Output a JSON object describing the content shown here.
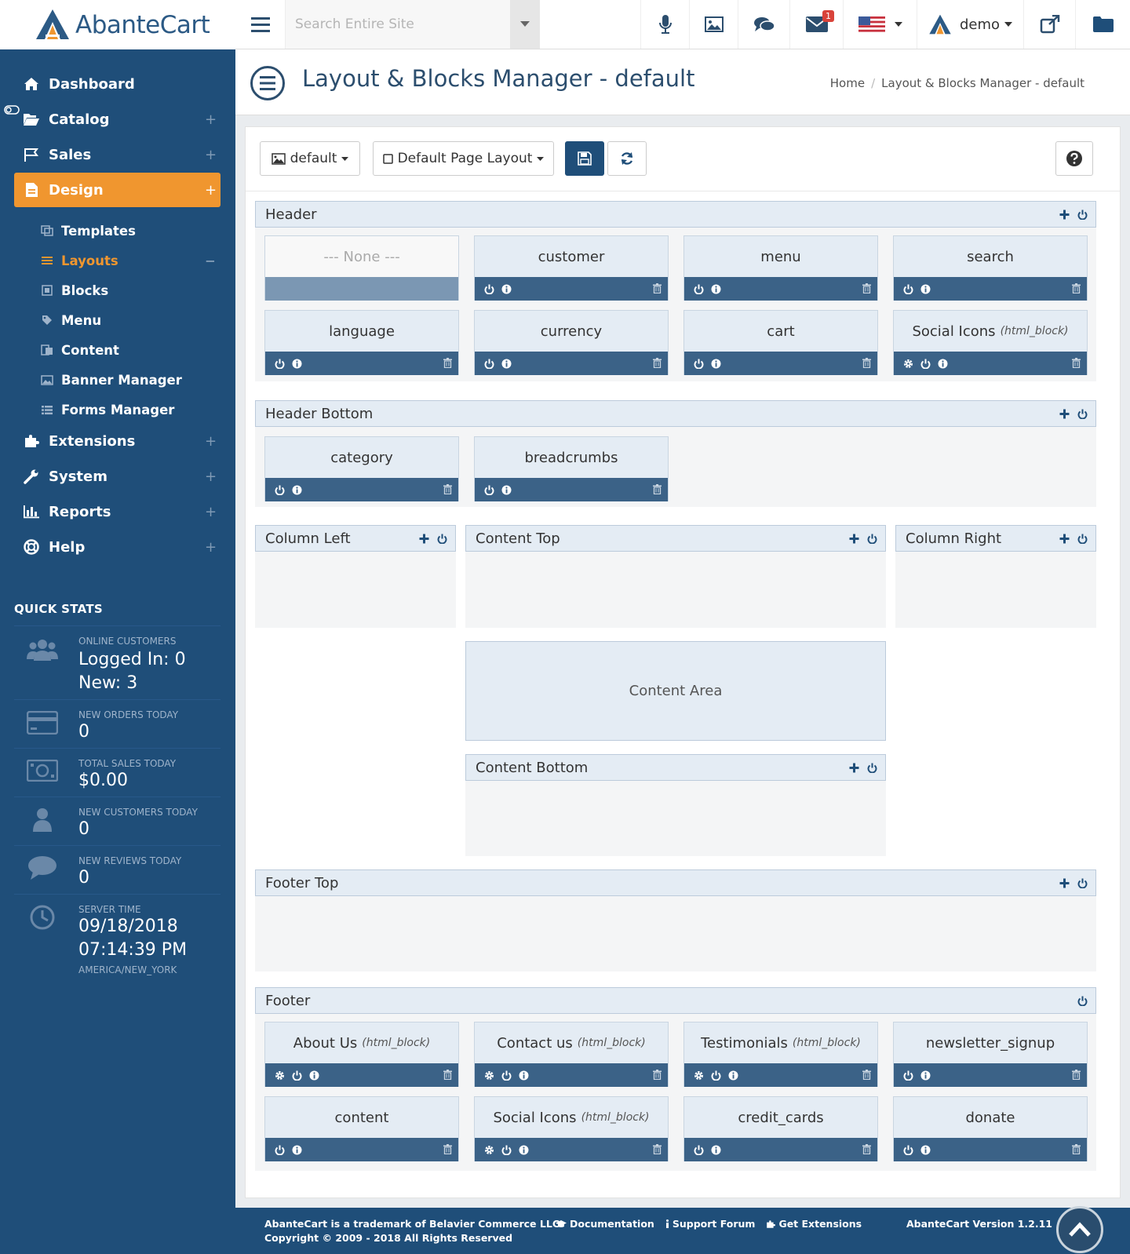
{
  "app": {
    "brand": "AbanteCart"
  },
  "topbar": {
    "search_placeholder": "Search Entire Site",
    "notification_count": "1",
    "user_name": "demo",
    "icons": [
      "microphone-icon",
      "image-icon",
      "chat-icon",
      "envelope-icon",
      "us-flag-icon",
      "external-link-icon",
      "folder-icon"
    ]
  },
  "sidebar": {
    "items": [
      {
        "label": "Dashboard",
        "icon": "home-icon"
      },
      {
        "label": "Catalog",
        "icon": "folder-open-icon"
      },
      {
        "label": "Sales",
        "icon": "flag-icon"
      },
      {
        "label": "Design",
        "icon": "file-icon",
        "active": true
      },
      {
        "label": "Extensions",
        "icon": "puzzle-icon"
      },
      {
        "label": "System",
        "icon": "wrench-icon"
      },
      {
        "label": "Reports",
        "icon": "bar-chart-icon"
      },
      {
        "label": "Help",
        "icon": "life-ring-icon"
      }
    ],
    "plus": "+",
    "minus": "−",
    "sub_items": [
      {
        "label": "Templates"
      },
      {
        "label": "Layouts",
        "current": true
      },
      {
        "label": "Blocks"
      },
      {
        "label": "Menu"
      },
      {
        "label": "Content"
      },
      {
        "label": "Banner Manager"
      },
      {
        "label": "Forms Manager"
      }
    ]
  },
  "quick_stats": {
    "title": "QUICK STATS",
    "online": {
      "label": "ONLINE CUSTOMERS",
      "logged_in": "Logged In: 0",
      "new": "New: 3"
    },
    "orders": {
      "label": "NEW ORDERS TODAY",
      "value": "0"
    },
    "sales": {
      "label": "TOTAL SALES TODAY",
      "value": "$0.00"
    },
    "customers": {
      "label": "NEW CUSTOMERS TODAY",
      "value": "0"
    },
    "reviews": {
      "label": "NEW REVIEWS TODAY",
      "value": "0"
    },
    "server": {
      "label": "SERVER TIME",
      "date": "09/18/2018",
      "time": "07:14:39 PM",
      "tz": "AMERICA/NEW_YORK"
    }
  },
  "page": {
    "title": "Layout & Blocks Manager - default",
    "breadcrumb_home": "Home",
    "breadcrumb_sep": "/",
    "breadcrumb_current": "Layout & Blocks Manager - default"
  },
  "toolbar": {
    "template_label": "default",
    "layout_label": "Default Page Layout"
  },
  "sections": {
    "header": {
      "title": "Header",
      "blocks": [
        {
          "name": "--- None ---",
          "none": true
        },
        {
          "name": "customer"
        },
        {
          "name": "menu"
        },
        {
          "name": "search"
        },
        {
          "name": "language"
        },
        {
          "name": "currency"
        },
        {
          "name": "cart"
        },
        {
          "name": "Social Icons",
          "type": "(html_block)",
          "gear": true
        }
      ]
    },
    "header_bottom": {
      "title": "Header Bottom",
      "blocks": [
        {
          "name": "category"
        },
        {
          "name": "breadcrumbs"
        }
      ]
    },
    "column_left": {
      "title": "Column Left"
    },
    "content_top": {
      "title": "Content Top"
    },
    "column_right": {
      "title": "Column Right"
    },
    "content_area": "Content Area",
    "content_bottom": {
      "title": "Content Bottom"
    },
    "footer_top": {
      "title": "Footer Top"
    },
    "footer": {
      "title": "Footer",
      "blocks": [
        {
          "name": "About Us",
          "type": "(html_block)",
          "gear": true
        },
        {
          "name": "Contact us",
          "type": "(html_block)",
          "gear": true
        },
        {
          "name": "Testimonials",
          "type": "(html_block)",
          "gear": true
        },
        {
          "name": "newsletter_signup"
        },
        {
          "name": "content"
        },
        {
          "name": "Social Icons",
          "type": "(html_block)",
          "gear": true
        },
        {
          "name": "credit_cards"
        },
        {
          "name": "donate"
        }
      ]
    }
  },
  "footer": {
    "trademark": "AbanteCart is a trademark of Belavier Commerce LLC",
    "copyright": "Copyright © 2009 - 2018 All Rights Reserved",
    "documentation": "Documentation",
    "support": "Support Forum",
    "extensions": "Get Extensions",
    "version": "AbanteCart Version 1.2.11"
  },
  "colors": {
    "sidebar": "#1f4e79",
    "accent": "#f0962f",
    "block_bar": "#3b6287",
    "section_head": "#e4ecf4"
  }
}
